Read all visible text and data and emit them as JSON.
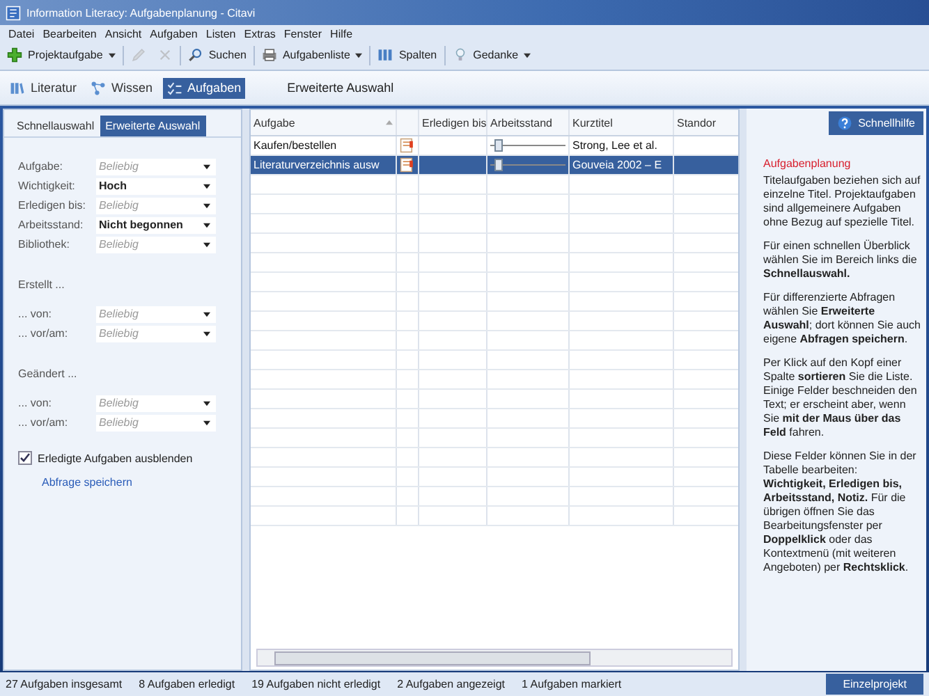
{
  "window": {
    "title": "Information Literacy: Aufgabenplanung - Citavi"
  },
  "menu": [
    "Datei",
    "Bearbeiten",
    "Ansicht",
    "Aufgaben",
    "Listen",
    "Extras",
    "Fenster",
    "Hilfe"
  ],
  "toolbar": [
    {
      "kind": "plus",
      "label": "Projektaufgabe",
      "dropdown": true
    },
    {
      "kind": "pencil",
      "disabled": true
    },
    {
      "kind": "delete",
      "disabled": true
    },
    {
      "kind": "search",
      "label": "Suchen"
    },
    {
      "kind": "print",
      "label": "Aufgabenliste",
      "dropdown": true
    },
    {
      "kind": "columns",
      "label": "Spalten"
    },
    {
      "kind": "bulb",
      "label": "Gedanke",
      "dropdown": true
    }
  ],
  "nav_tabs": [
    {
      "kind": "books",
      "label": "Literatur",
      "selected": false
    },
    {
      "kind": "nodes",
      "label": "Wissen",
      "selected": false
    },
    {
      "kind": "tasks",
      "label": "Aufgaben",
      "selected": true
    }
  ],
  "view_title": "Erweiterte Auswahl",
  "filter_tabs": [
    {
      "label": "Schnellauswahl",
      "selected": false
    },
    {
      "label": "Erweiterte Auswahl",
      "selected": true
    }
  ],
  "filters": [
    {
      "label": "Aufgabe:",
      "placeholder": "Beliebig"
    },
    {
      "label": "Wichtigkeit:",
      "value": "Hoch"
    },
    {
      "label": "Erledigen bis:",
      "placeholder": "Beliebig"
    },
    {
      "label": "Arbeitsstand:",
      "value": "Nicht begonnen"
    },
    {
      "label": "Bibliothek:",
      "placeholder": "Beliebig"
    }
  ],
  "created": {
    "heading": "Erstellt ...",
    "filters": [
      {
        "label": "... von:",
        "placeholder": "Beliebig"
      },
      {
        "label": "... vor/am:",
        "placeholder": "Beliebig"
      }
    ]
  },
  "changed": {
    "heading": "Geändert ...",
    "filters": [
      {
        "label": "... von:",
        "placeholder": "Beliebig"
      },
      {
        "label": "... vor/am:",
        "placeholder": "Beliebig"
      }
    ]
  },
  "hide_done": {
    "label": "Erledigte Aufgaben ausblenden",
    "checked": true
  },
  "save_query": "Abfrage speichern",
  "table": {
    "columns": [
      "Aufgabe",
      "",
      "Erledigen bis",
      "Arbeitsstand",
      "Kurztitel",
      "Standor"
    ],
    "rows": [
      {
        "task": "Kaufen/bestellen",
        "progress": {
          "level": 0.05
        },
        "short_title": "Strong, Lee et al.",
        "selected": false
      },
      {
        "task": "Literaturverzeichnis ausw",
        "progress": {
          "level": 0.05
        },
        "short_title": "Gouveia 2002 – E",
        "selected": true
      }
    ]
  },
  "help": {
    "button": "Schnellhilfe",
    "title": "Aufgabenplanung",
    "paragraphs": [
      "Titelaufgaben beziehen sich auf einzelne Titel. Projektaufgaben sind allgemeinere Aufgaben ohne Bezug auf spezielle Titel.",
      "Für einen schnellen Überblick wählen Sie im Bereich links die **Schnellauswahl.**",
      "Für differenzierte Abfragen wählen Sie **Erweiterte Auswahl**; dort können Sie auch eigene **Abfragen speichern**.",
      "Per Klick auf den Kopf einer Spalte **sortieren** Sie die Liste. Einige Felder beschneiden den Text; er erscheint aber, wenn Sie **mit der Maus über das Feld** fahren.",
      "Diese Felder können Sie in der Tabelle bearbeiten: **Wichtigkeit, Erledigen bis, Arbeitsstand, Notiz.** Für die übrigen öffnen Sie das Bearbeitungsfenster per **Doppelklick** oder das Kontextmenü (mit weiteren Angeboten) per **Rechtsklick**."
    ]
  },
  "status_bar": {
    "items": [
      "27 Aufgaben insgesamt",
      "8 Aufgaben erledigt",
      "19 Aufgaben nicht erledigt",
      "2 Aufgaben angezeigt",
      "1 Aufgaben markiert"
    ],
    "button": "Einzelprojekt"
  }
}
